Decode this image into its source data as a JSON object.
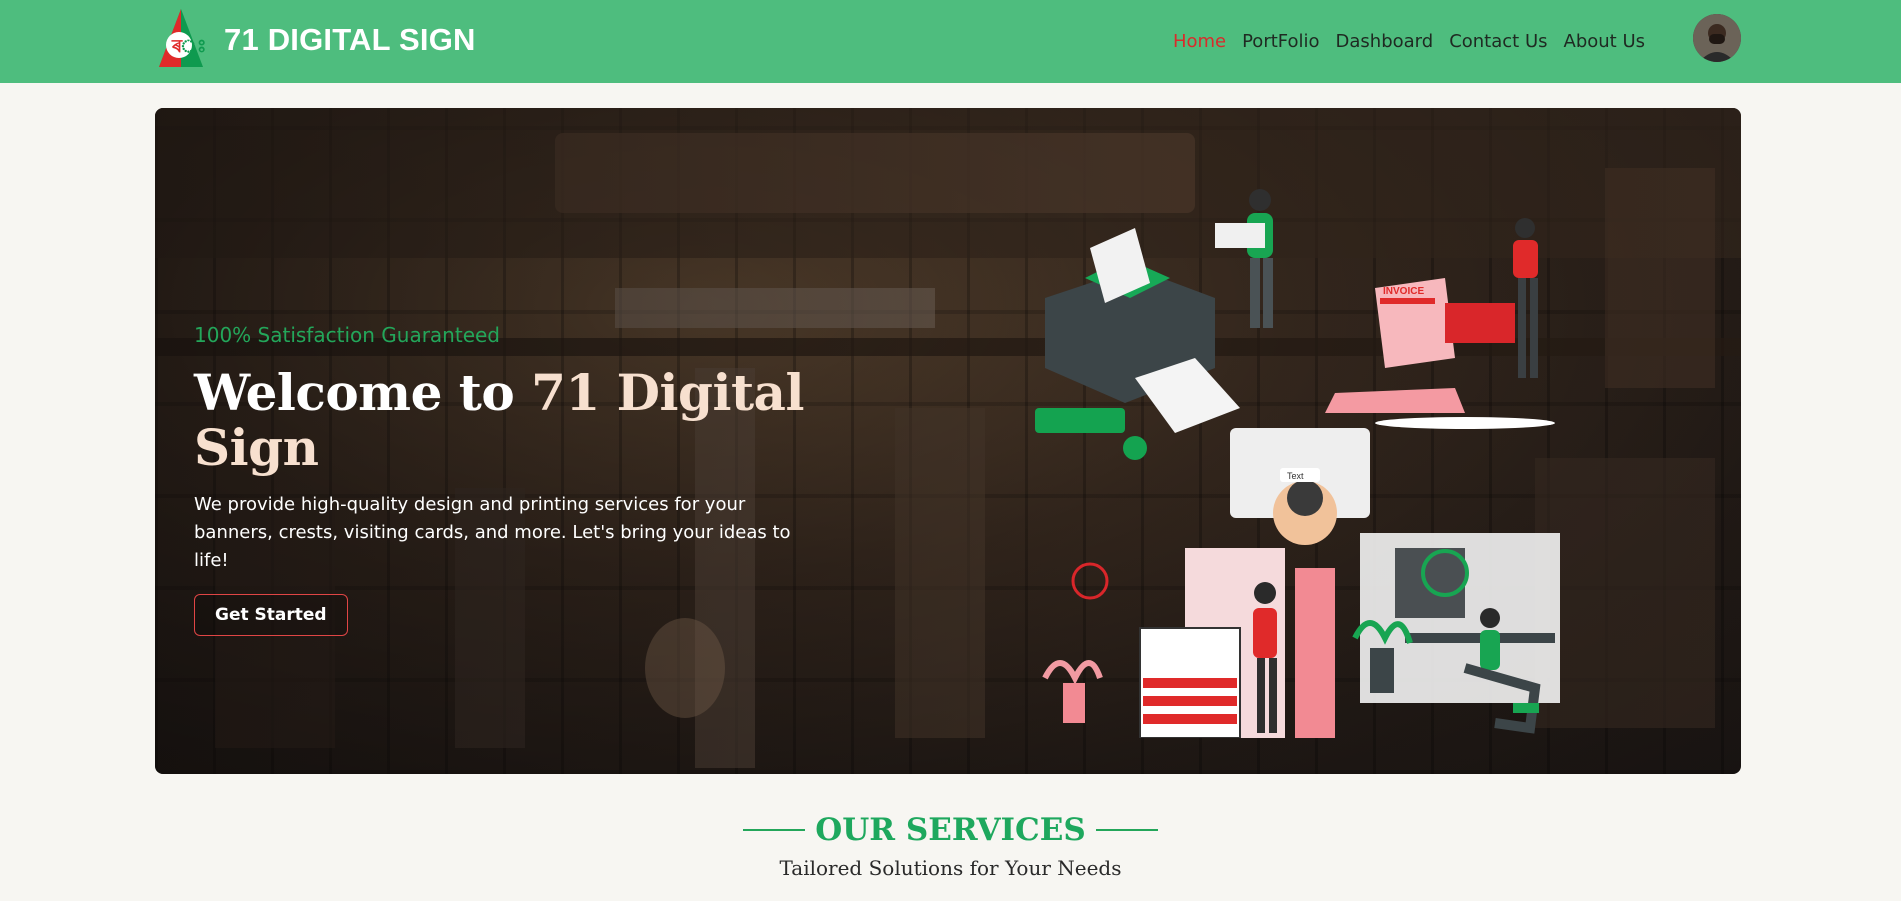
{
  "header": {
    "brand_name": "71 DIGITAL SIGN",
    "logo_icon": "brand-logo-icon",
    "nav": [
      {
        "label": "Home",
        "active": true
      },
      {
        "label": "PortFolio",
        "active": false
      },
      {
        "label": "Dashboard",
        "active": false
      },
      {
        "label": "Contact Us",
        "active": false
      },
      {
        "label": "About Us",
        "active": false
      }
    ],
    "avatar_icon": "user-avatar-icon",
    "bg_color": "#4ebd7e"
  },
  "hero": {
    "tagline": "100% Satisfaction Guaranteed",
    "title_main": "Welcome to ",
    "title_accent": "71 Digital Sign",
    "description": "We provide high-quality design and printing services for your banners, crests, visiting cards, and more. Let's bring your ideas to life!",
    "cta_label": "Get Started",
    "illustration_icon": "printing-office-illustration",
    "illustration_text": {
      "invoice": "INVOICE",
      "screen": "Text"
    }
  },
  "services": {
    "title": "OUR SERVICES",
    "subtitle": "Tailored Solutions for Your Needs"
  },
  "colors": {
    "accent_green": "#1ea85e",
    "accent_red": "#d92b2b",
    "page_bg": "#f7f6f2"
  }
}
